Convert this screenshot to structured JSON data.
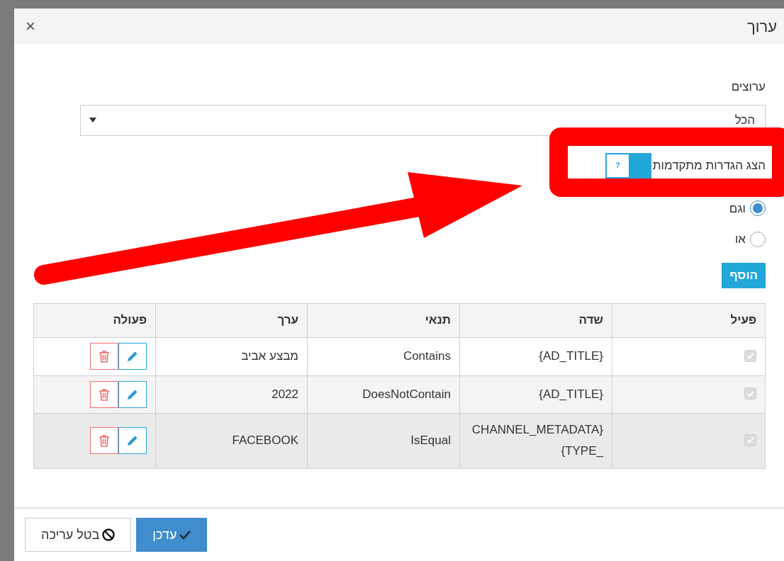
{
  "dialog": {
    "title": "ערוך",
    "close": "×"
  },
  "channels": {
    "label": "ערוצים",
    "value": "הכל"
  },
  "advanced_toggle": {
    "label": "הצג הגדרות מתקדמות",
    "text": "?",
    "on": true
  },
  "logic": [
    {
      "label": "וגם",
      "selected": true
    },
    {
      "label": "או",
      "selected": false
    }
  ],
  "add_button": "הוסף",
  "table": {
    "columns": [
      "פעיל",
      "שדה",
      "תנאי",
      "ערך",
      "פעולה"
    ],
    "rows": [
      {
        "active": true,
        "disabled": true,
        "field": "{AD_TITLE}",
        "condition": "Contains",
        "value": "מבצע אביב",
        "selected": false
      },
      {
        "active": true,
        "disabled": true,
        "field": "{AD_TITLE}",
        "condition": "DoesNotContain",
        "value": "2022",
        "selected": false
      },
      {
        "active": true,
        "disabled": true,
        "field": "{CHANNEL_METADATA\n_TYPE}",
        "condition": "IsEqual",
        "value": "FACEBOOK",
        "selected": true
      }
    ]
  },
  "footer": {
    "buttons": [
      {
        "kind": "primary",
        "label": "עדכן"
      },
      {
        "kind": "cancel",
        "label": "בטל עריכה"
      }
    ]
  }
}
